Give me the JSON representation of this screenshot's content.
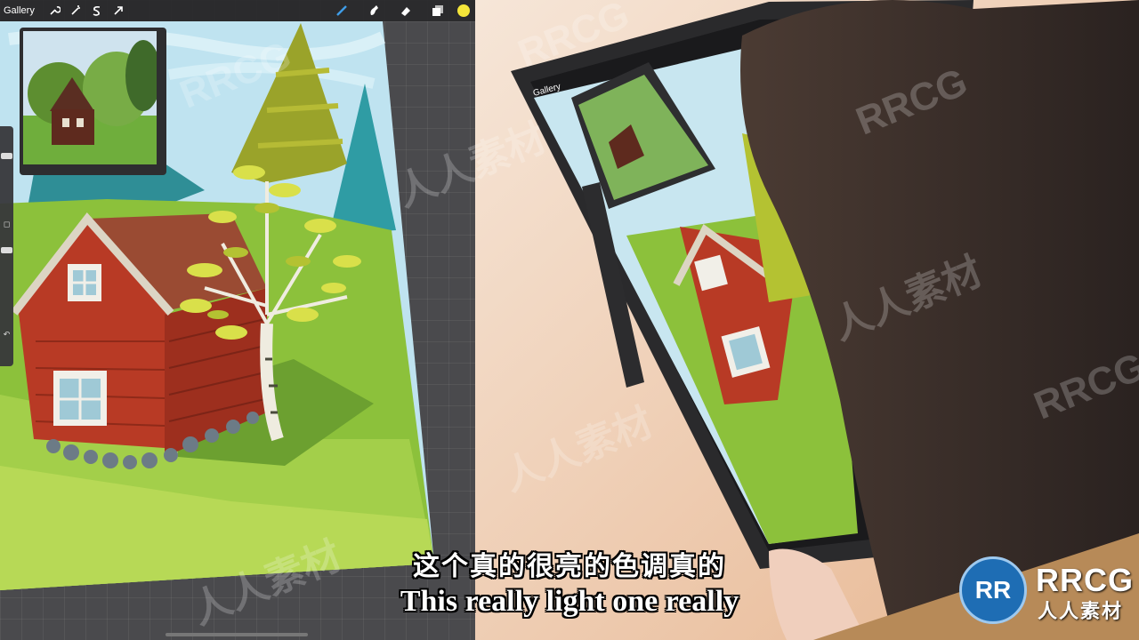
{
  "toolbar": {
    "gallery_label": "Gallery",
    "tools_left": [
      "wrench-icon",
      "magic-wand-icon",
      "selection-icon",
      "transform-icon"
    ],
    "tools_right": [
      "brush-icon",
      "smudge-icon",
      "eraser-icon",
      "layers-icon"
    ],
    "current_color": "#f5e63a"
  },
  "device_toolbar": {
    "gallery_label": "Gallery"
  },
  "subtitles": {
    "chinese": "这个真的很亮的色调真的",
    "english": "This really light one really"
  },
  "watermark": {
    "text_latin": "RRCG",
    "text_cn": "人人素材"
  },
  "logo": {
    "mark": "RR",
    "title": "RRCG",
    "subtitle": "人人素材"
  }
}
